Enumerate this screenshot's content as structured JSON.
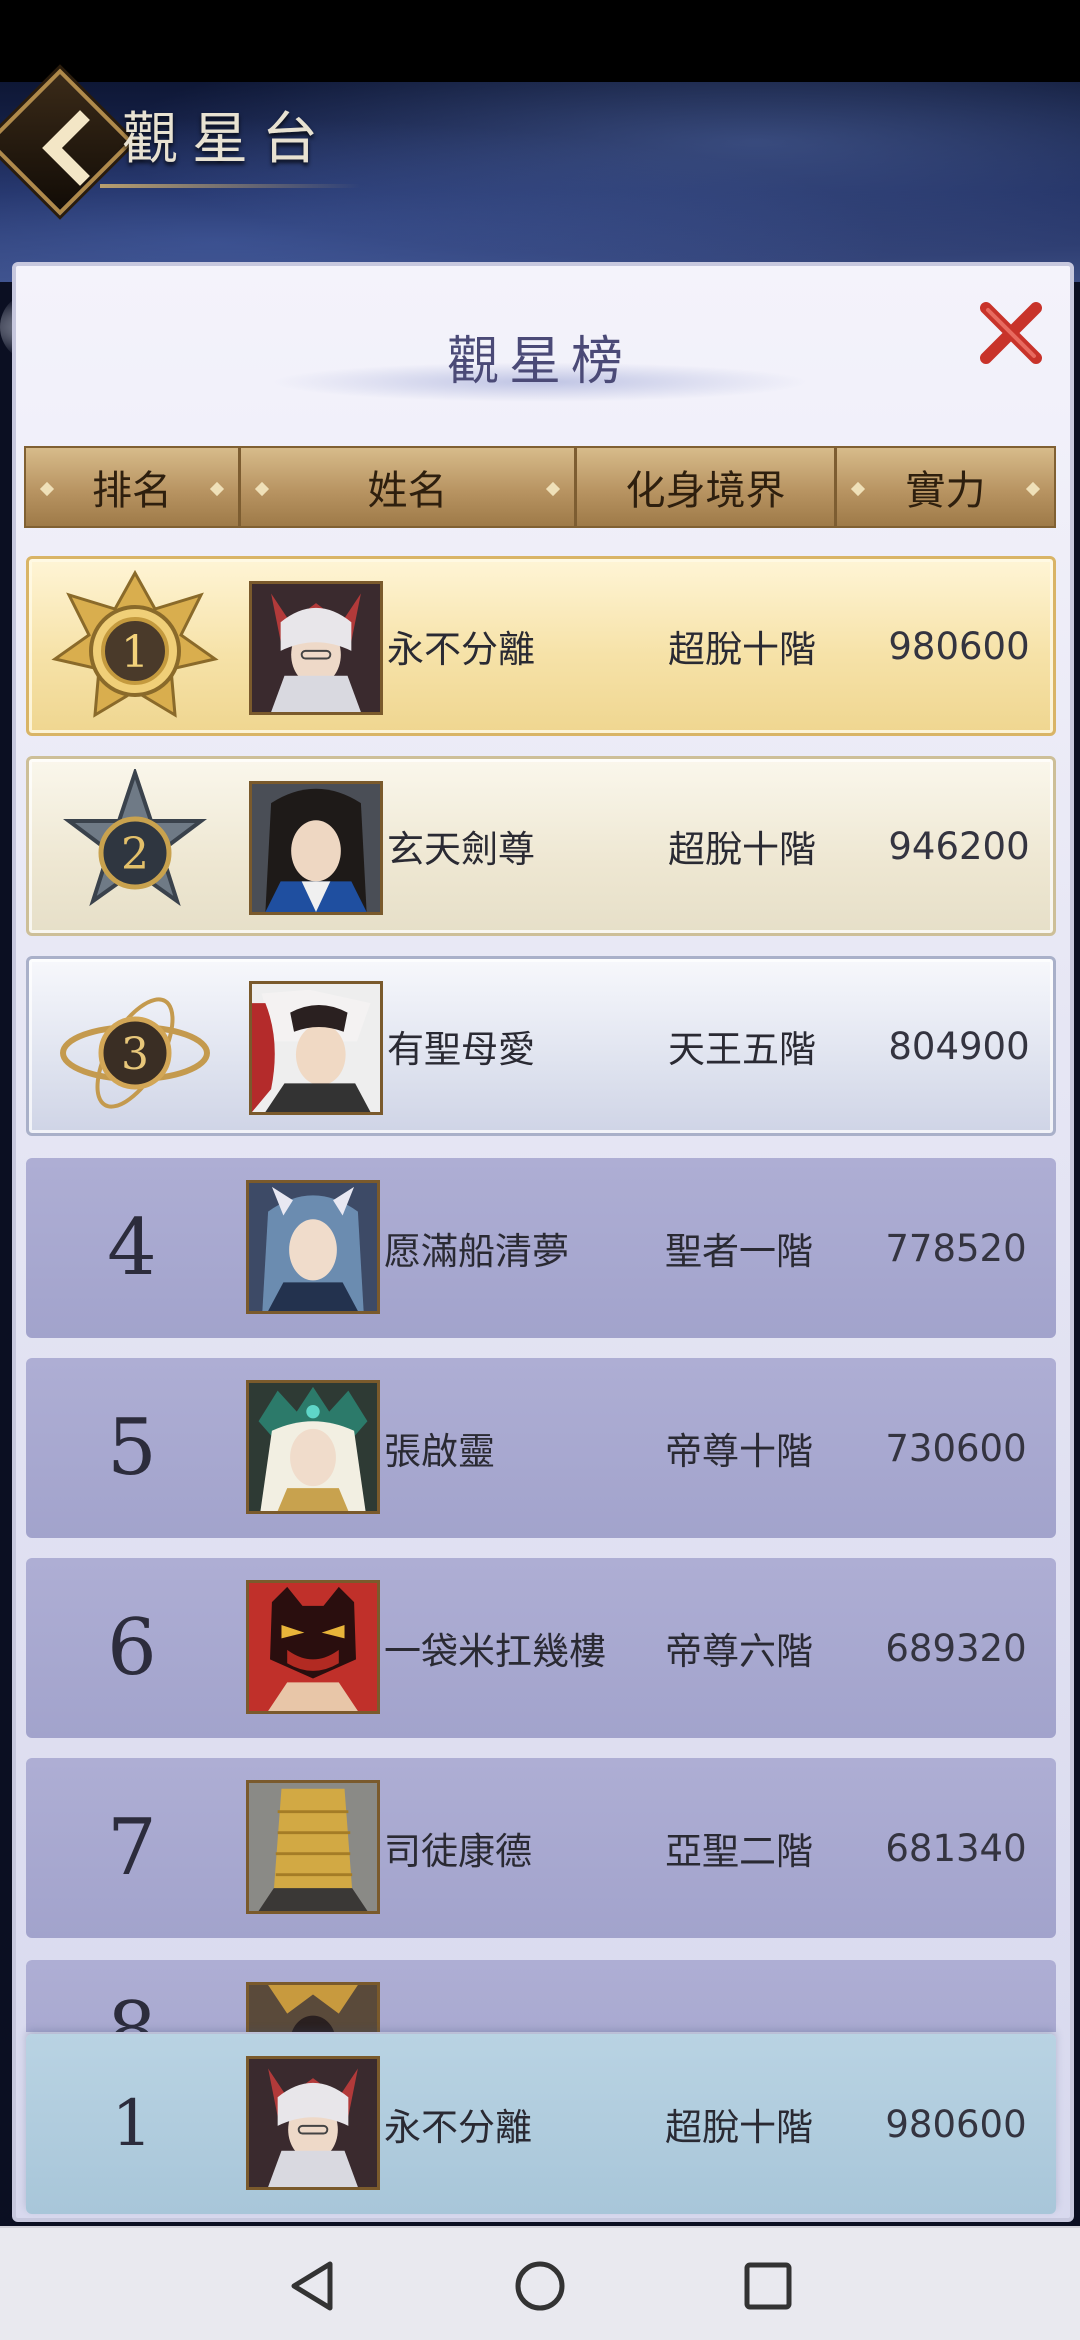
{
  "header": {
    "title": "觀星台"
  },
  "panel": {
    "title": "觀星榜"
  },
  "table": {
    "columns": [
      "排名",
      "姓名",
      "化身境界",
      "實力"
    ]
  },
  "rows": [
    {
      "rank": "1",
      "name": "永不分離",
      "realm": "超脫十階",
      "power": "980600",
      "medal": "gold"
    },
    {
      "rank": "2",
      "name": "玄天劍尊",
      "realm": "超脫十階",
      "power": "946200",
      "medal": "silver"
    },
    {
      "rank": "3",
      "name": "有聖母愛",
      "realm": "天王五階",
      "power": "804900",
      "medal": "bronze"
    },
    {
      "rank": "4",
      "name": "愿滿船清夢",
      "realm": "聖者一階",
      "power": "778520"
    },
    {
      "rank": "5",
      "name": "張啟靈",
      "realm": "帝尊十階",
      "power": "730600"
    },
    {
      "rank": "6",
      "name": "一袋米扛幾樓",
      "realm": "帝尊六階",
      "power": "689320"
    },
    {
      "rank": "7",
      "name": "司徒康德",
      "realm": "亞聖二階",
      "power": "681340"
    },
    {
      "rank": "8",
      "name": "",
      "realm": "",
      "power": ""
    }
  ],
  "self_row": {
    "rank": "1",
    "name": "永不分離",
    "realm": "超脫十階",
    "power": "980600"
  },
  "colors": {
    "gold_row": "#f6e2a8",
    "normal_row": "#a2a3cc",
    "self_row": "#a8c6d9",
    "header_gold": "#b89462",
    "close_red": "#c8332a"
  }
}
